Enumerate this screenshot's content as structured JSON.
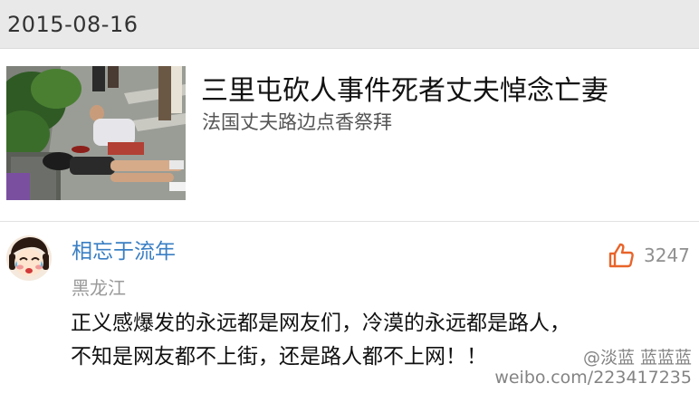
{
  "header": {
    "date": "2015-08-16"
  },
  "article": {
    "title": "三里屯砍人事件死者丈夫悼念亡妻",
    "subtitle": "法国丈夫路边点香祭拜",
    "thumbnail_icon": "news-photo"
  },
  "comment": {
    "username": "相忘于流年",
    "location": "黑龙江",
    "like_count": "3247",
    "like_icon": "thumbs-up-icon",
    "lines": [
      "正义感爆发的永远都是网友们，冷漠的永远都是路人，",
      "不知是网友都不上街，还是路人都不上网！！"
    ]
  },
  "watermark": {
    "handle": "@淡蓝 蓝蓝蓝",
    "url": "weibo.com/223417235"
  },
  "colors": {
    "username": "#3a7fc4",
    "like_icon": "#e8642a",
    "header_bg": "#e9e9e9"
  }
}
